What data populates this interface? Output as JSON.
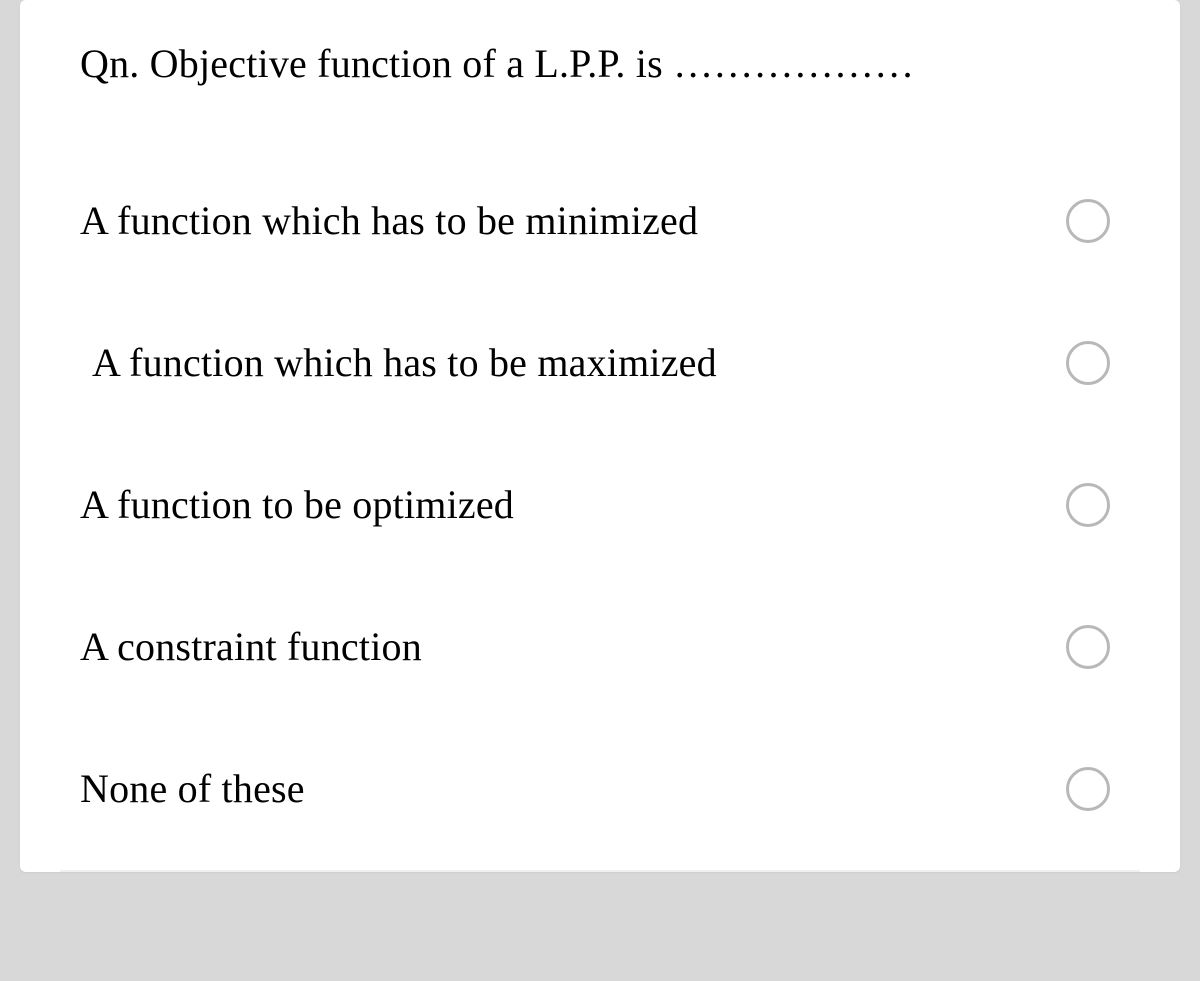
{
  "question": {
    "text": "Qn. Objective function of a L.P.P. is ………………"
  },
  "options": [
    {
      "label": "A  function which has to be minimized",
      "indent": false
    },
    {
      "label": "A  function which has to be maximized",
      "indent": true
    },
    {
      "label": "A function to be optimized",
      "indent": false
    },
    {
      "label": "A constraint function",
      "indent": false
    },
    {
      "label": "None of these",
      "indent": false
    }
  ]
}
